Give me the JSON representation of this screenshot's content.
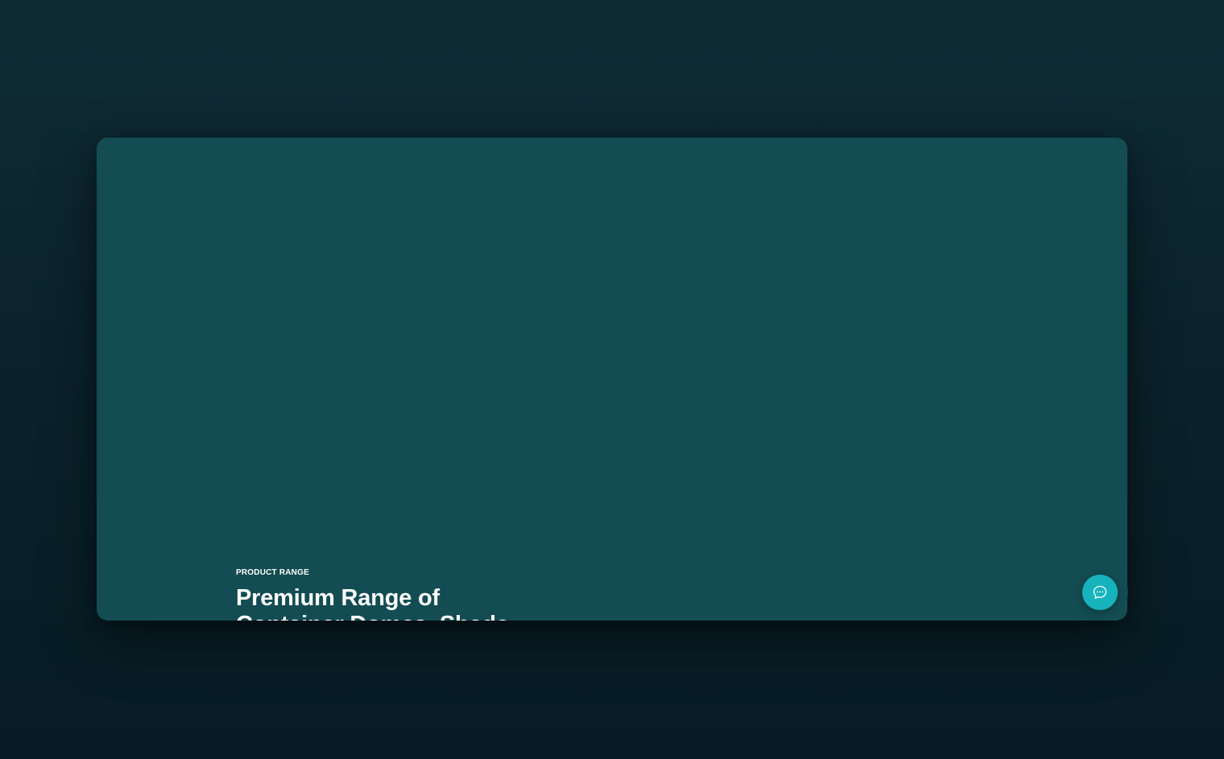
{
  "hero": {
    "eyebrow": "PRODUCT RANGE",
    "headline_line1": "Premium Range of",
    "headline_line2": "Container Domes, Shade"
  },
  "chat": {
    "icon": "chat-bubble-icon",
    "accent_color": "#17b3bd"
  },
  "colors": {
    "page_background": "#0b232c",
    "panel_background": "#134c52",
    "text": "#ffffff"
  }
}
